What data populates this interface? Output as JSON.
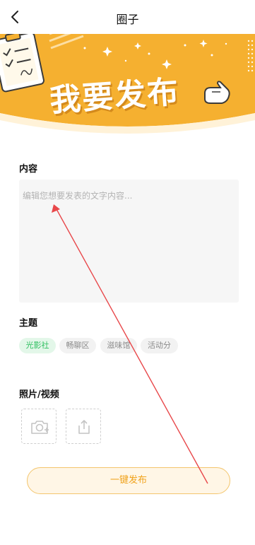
{
  "nav": {
    "title": "圈子"
  },
  "banner": {
    "title": "我要发布"
  },
  "content": {
    "label": "内容",
    "placeholder": "编辑您想要发表的文字内容...",
    "value": ""
  },
  "topic": {
    "label": "主题",
    "tags": [
      {
        "label": "光影社",
        "selected": true
      },
      {
        "label": "畅聊区",
        "selected": false
      },
      {
        "label": "滋味馆",
        "selected": false
      },
      {
        "label": "活动分",
        "selected": false
      }
    ]
  },
  "media": {
    "label": "照片/视频",
    "buttons": [
      "camera-icon",
      "upload-icon"
    ]
  },
  "publish": {
    "label": "一键发布"
  },
  "colors": {
    "accent": "#f5b030",
    "selected_tag_text": "#2ebf5f",
    "annotation": "#e8474a"
  }
}
